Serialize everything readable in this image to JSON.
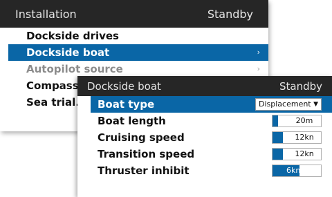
{
  "installation": {
    "title": "Installation",
    "status": "Standby",
    "items": [
      {
        "label": "Dockside drives",
        "chevron": ""
      },
      {
        "label": "Dockside boat",
        "chevron": "›"
      },
      {
        "label": "Autopilot source",
        "chevron": "›"
      },
      {
        "label": "Compass c",
        "chevron": ""
      },
      {
        "label": "Sea trial...",
        "chevron": ""
      }
    ]
  },
  "dockside_boat": {
    "title": "Dockside boat",
    "status": "Standby",
    "boat_type": {
      "label": "Boat type",
      "value": "Displacement",
      "arrow": "▼"
    },
    "boat_length": {
      "label": "Boat length",
      "value": "20m",
      "fill": 0.12
    },
    "cruising_speed": {
      "label": "Cruising speed",
      "value": "12kn",
      "fill": 0.22
    },
    "transition_speed": {
      "label": "Transition speed",
      "value": "12kn",
      "fill": 0.22
    },
    "thruster_inhibit": {
      "label": "Thruster inhibit",
      "value": "6kn",
      "fill": 0.55
    }
  },
  "colors": {
    "accent": "#0a66a6",
    "titlebar": "#262626"
  }
}
